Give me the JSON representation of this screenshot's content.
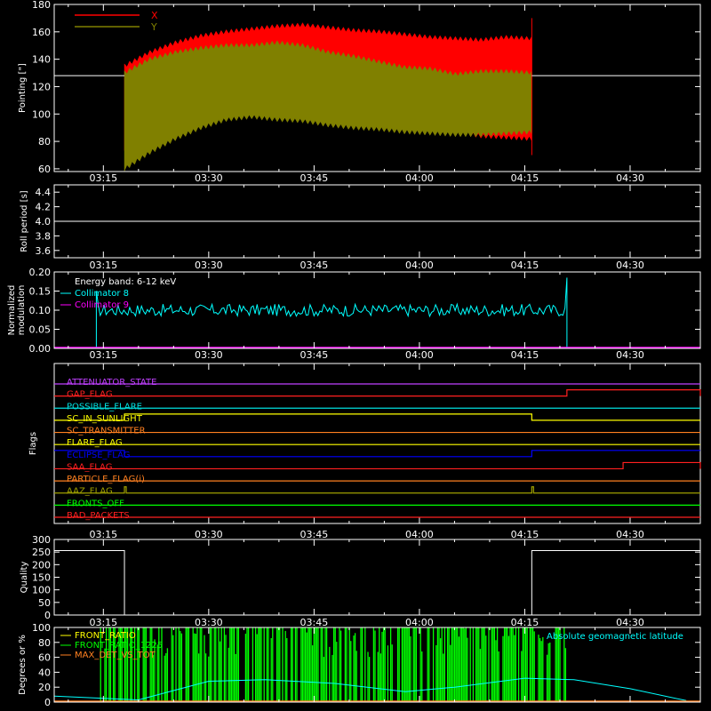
{
  "time_ticks": [
    "03:15",
    "03:30",
    "03:45",
    "04:00",
    "04:15",
    "04:30"
  ],
  "chart_data": [
    {
      "type": "area",
      "ylabel": "Pointing [\"]",
      "ylim": [
        58,
        180
      ],
      "yticks": [
        60,
        80,
        100,
        120,
        140,
        160,
        180
      ],
      "legend": [
        {
          "name": "X",
          "color": "#ff0000"
        },
        {
          "name": "Y",
          "color": "#808000"
        }
      ],
      "reference_line": {
        "value": 128,
        "color": "#ffffff"
      },
      "data_start": "03:18",
      "data_end": "04:16",
      "series": [
        {
          "name": "X",
          "color": "#ff0000",
          "upper": [
            135,
            145,
            152,
            157,
            160,
            162,
            164,
            165,
            163,
            161,
            160,
            158,
            156,
            155,
            154,
            156,
            155
          ],
          "lower": [
            75,
            88,
            95,
            102,
            107,
            110,
            108,
            100,
            98,
            96,
            93,
            91,
            90,
            87,
            84,
            83,
            82
          ]
        },
        {
          "name": "Y",
          "color": "#808000",
          "upper": [
            130,
            140,
            145,
            148,
            150,
            150,
            152,
            150,
            145,
            142,
            138,
            134,
            133,
            129,
            131,
            131,
            130
          ],
          "lower": [
            60,
            72,
            82,
            90,
            96,
            98,
            96,
            95,
            92,
            90,
            89,
            87,
            86,
            85,
            85,
            86,
            87
          ]
        }
      ]
    },
    {
      "type": "line",
      "ylabel": "Roll period [s]",
      "ylim": [
        3.5,
        4.5
      ],
      "yticks": [
        "3.6",
        "3.8",
        "4.0",
        "4.2",
        "4.4"
      ],
      "series": [
        {
          "name": "",
          "color": "#ffffff",
          "value": 4.0
        }
      ]
    },
    {
      "type": "line",
      "ylabel": "Normalized modulation",
      "ylim": [
        0,
        0.2
      ],
      "yticks": [
        "0.00",
        "0.05",
        "0.10",
        "0.15",
        "0.20"
      ],
      "legend_title": "Energy band: 6-12 keV",
      "legend": [
        {
          "name": "Collimator 8",
          "color": "#00ffff"
        },
        {
          "name": "Collimator 9",
          "color": "#ff00ff"
        }
      ],
      "series": [
        {
          "name": "Collimator 8",
          "color": "#00ffff",
          "start": "03:14",
          "end": "04:21",
          "mean": 0.1,
          "spread": 0.01
        },
        {
          "name": "Collimator 9",
          "color": "#ff00ff",
          "value": 0.0
        }
      ]
    },
    {
      "type": "line",
      "ylabel": "Flags",
      "flags": [
        {
          "name": "ATTENUATOR_STATE",
          "color": "#c040ff",
          "high_ranges": []
        },
        {
          "name": "GAP_FLAG",
          "color": "#ff2020",
          "high_ranges": [
            [
              "04:21",
              "04:40"
            ]
          ]
        },
        {
          "name": "POSSIBLE_FLARE",
          "color": "#00e0e0",
          "high_ranges": []
        },
        {
          "name": "SC_IN_SUNLIGHT",
          "color": "#ffff00",
          "high_ranges": [
            [
              "03:18",
              "04:16"
            ]
          ]
        },
        {
          "name": "SC_TRANSMITTER",
          "color": "#ff8020",
          "high_ranges": []
        },
        {
          "name": "FLARE_FLAG",
          "color": "#ffff00",
          "high_ranges": []
        },
        {
          "name": "ECLIPSE_FLAG",
          "color": "#0000ff",
          "high_ranges": [
            [
              "03:08",
              "03:18"
            ],
            [
              "04:16",
              "04:40"
            ]
          ]
        },
        {
          "name": "SAA_FLAG",
          "color": "#ff2020",
          "high_ranges": [
            [
              "04:29",
              "04:40"
            ]
          ]
        },
        {
          "name": "PARTICLE_FLAG(i)",
          "color": "#ff8020",
          "high_ranges": []
        },
        {
          "name": "AAZ_FLAG",
          "color": "#a0a000",
          "high_ranges": [
            [
              "03:18",
              "03:18"
            ],
            [
              "04:16",
              "04:16"
            ]
          ]
        },
        {
          "name": "FRONTS_OFF",
          "color": "#00ff00",
          "high_ranges": []
        },
        {
          "name": "BAD_PACKETS",
          "color": "#ff2020",
          "high_ranges": []
        }
      ]
    },
    {
      "type": "line",
      "ylabel": "Quality",
      "ylim": [
        0,
        300
      ],
      "yticks": [
        "0",
        "50",
        "100",
        "150",
        "200",
        "250",
        "300"
      ],
      "series": [
        {
          "name": "",
          "color": "#ffffff",
          "segments": [
            {
              "start": "03:08",
              "end": "03:18",
              "value": 256
            },
            {
              "start": "03:18",
              "end": "04:16",
              "value": 0
            },
            {
              "start": "04:16",
              "end": "04:40",
              "value": 256
            }
          ]
        }
      ]
    },
    {
      "type": "line",
      "ylabel": "Degrees or %",
      "ylim": [
        0,
        100
      ],
      "yticks": [
        "0",
        "20",
        "40",
        "60",
        "80",
        "100"
      ],
      "legend": [
        {
          "name": "FRONT_RATIO",
          "color": "#ffff00"
        },
        {
          "name": "FRONT_RATIO_1225",
          "color": "#00ff00"
        },
        {
          "name": "MAX_DET_VS_TOT",
          "color": "#ff8020"
        }
      ],
      "right_label": {
        "text": "Absolute geomagnetic latitude",
        "color": "#00ffff"
      },
      "series": [
        {
          "name": "Absolute geomagnetic latitude",
          "color": "#00ffff",
          "x": [
            "03:08",
            "03:20",
            "03:30",
            "03:38",
            "03:48",
            "03:58",
            "04:05",
            "04:15",
            "04:22",
            "04:30",
            "04:38"
          ],
          "values": [
            8,
            3,
            28,
            30,
            25,
            14,
            20,
            32,
            30,
            18,
            2
          ]
        },
        {
          "name": "FRONT_RATIO_1225",
          "color": "#00ff00",
          "start": "03:14",
          "end": "04:21",
          "values_percent": [
            100,
            0
          ]
        },
        {
          "name": "MAX_DET_VS_TOT",
          "color": "#ff8020",
          "value": 0
        }
      ]
    }
  ]
}
